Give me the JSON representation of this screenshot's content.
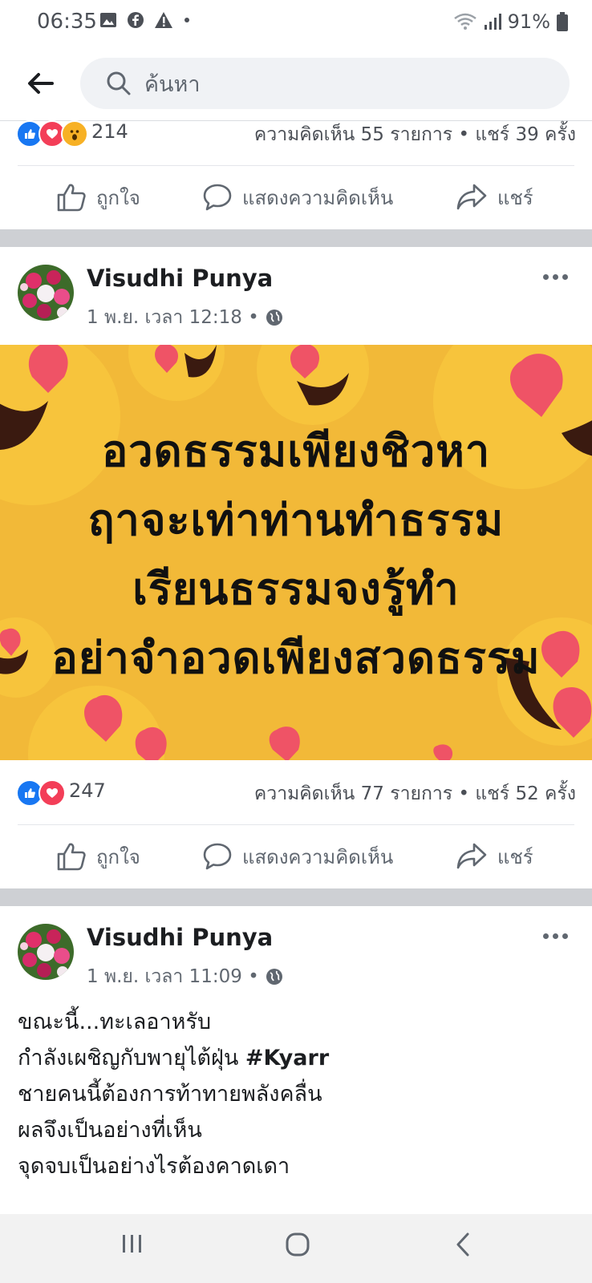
{
  "status_bar": {
    "time": "06:35",
    "battery": "91%",
    "notification_icons": [
      "gallery-icon",
      "facebook-icon",
      "warning-icon",
      "dot-icon"
    ]
  },
  "search": {
    "placeholder": "ค้นหา"
  },
  "prev_post": {
    "reaction_count": "214",
    "meta": "ความคิดเห็น 55 รายการ • แชร์ 39 ครั้ง"
  },
  "actions": {
    "like": "ถูกใจ",
    "comment": "แสดงความคิดเห็น",
    "share": "แชร์"
  },
  "post1": {
    "author": "Visudhi Punya",
    "time": "1 พ.ย. เวลา 12:18 •",
    "image_text": [
      "อวดธรรมเพียงชิวหา",
      "ฤาจะเท่าท่านทำธรรม",
      "เรียนธรรมจงรู้ทำ",
      "อย่าจำอวดเพียงสวดธรรม"
    ],
    "reaction_count": "247",
    "meta": "ความคิดเห็น 77 รายการ • แชร์ 52 ครั้ง"
  },
  "post2": {
    "author": "Visudhi Punya",
    "time": "1 พ.ย. เวลา 11:09 •",
    "text_lines": [
      "ขณะนี้...ทะเลอาหรับ",
      "กำลังเผชิญกับพายุไต้ฝุ่น ",
      "ชายคนนี้ต้องการท้าทายพลังคลื่น",
      "ผลจึงเป็นอย่างที่เห็น",
      "จุดจบเป็นอย่างไรต้องคาดเดา"
    ],
    "hashtag": "#Kyarr"
  },
  "colors": {
    "accent": "#1877f2",
    "love": "#f33e58",
    "image_bg": "#f2b938"
  }
}
